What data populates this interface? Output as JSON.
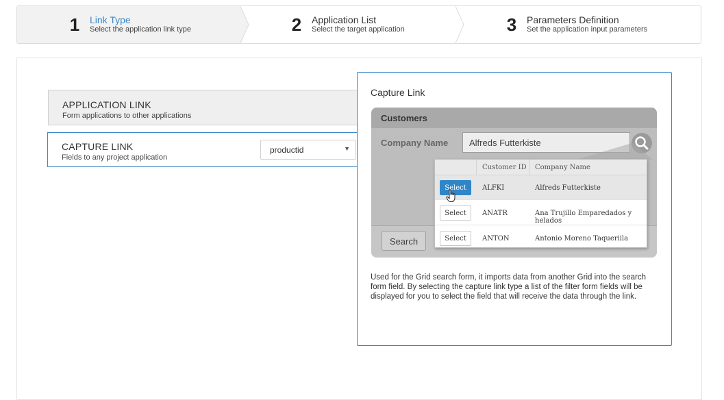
{
  "wizard": {
    "steps": [
      {
        "number": "1",
        "title": "Link Type",
        "subtitle": "Select the application link type"
      },
      {
        "number": "2",
        "title": "Application List",
        "subtitle": "Select the target application"
      },
      {
        "number": "3",
        "title": "Parameters Definition",
        "subtitle": "Set the application input parameters"
      }
    ]
  },
  "options": {
    "application_link": {
      "title": "APPLICATION LINK",
      "subtitle": "Form applications to other applications"
    },
    "capture_link": {
      "title": "CAPTURE LINK",
      "subtitle": "Fields to any project application",
      "selected_field": "productid"
    }
  },
  "preview": {
    "title": "Capture Link",
    "mock": {
      "header": "Customers",
      "field_label": "Company Name",
      "field_value": "Alfreds Futterkiste",
      "search_button": "Search",
      "columns": [
        "Customer ID",
        "Company Name"
      ],
      "rows": [
        {
          "button": "Select",
          "id": "ALFKI",
          "name": "Alfreds Futterkiste"
        },
        {
          "button": "Select",
          "id": "ANATR",
          "name": "Ana Trujillo Emparedados y helados"
        },
        {
          "button": "Select",
          "id": "ANTON",
          "name": "Antonio Moreno Taqueriila"
        }
      ]
    },
    "description": "Used for the Grid search form, it imports data from another Grid into the search form field. By selecting the capture link type a list of the filter form fields will be displayed for you to select the field that will receive the data through the link."
  },
  "colors": {
    "accent": "#3a87c8",
    "select_button": "#2e86c9"
  }
}
